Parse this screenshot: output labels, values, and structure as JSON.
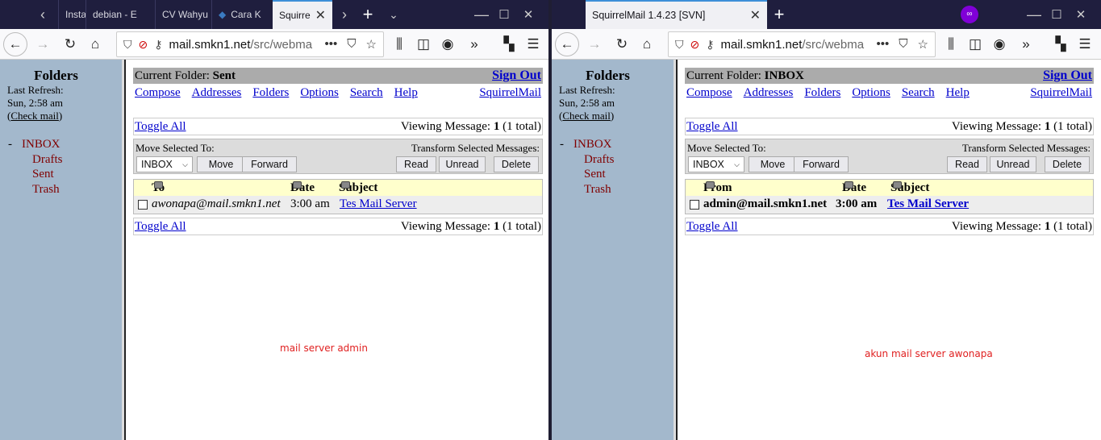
{
  "windows": [
    {
      "tabs": [
        "Install",
        "debian - E",
        "CV Wahyu",
        "Cara K",
        "Squirre"
      ],
      "url": {
        "host": "mail.smkn1.net",
        "path": "/src/webma"
      },
      "folders": {
        "title": "Folders",
        "last_refresh": "Last Refresh:",
        "time": "Sun, 2:58 am",
        "check_mail": "Check mail",
        "items": [
          "INBOX",
          "Drafts",
          "Sent",
          "Trash"
        ],
        "collapse": "-"
      },
      "current_folder_label": "Current Folder:",
      "current_folder": "Sent",
      "sign_out": "Sign Out",
      "nav": [
        "Compose",
        "Addresses",
        "Folders",
        "Options",
        "Search",
        "Help"
      ],
      "brand": "SquirrelMail",
      "toggle_all": "Toggle All",
      "viewing_label": "Viewing Message:",
      "viewing_num": "1",
      "viewing_total": "(1 total)",
      "move_label": "Move Selected To:",
      "transform_label": "Transform Selected Messages:",
      "move_select": "INBOX",
      "buttons": [
        "Move",
        "Forward",
        "Read",
        "Unread",
        "Delete"
      ],
      "columns": [
        "To",
        "Date",
        "Subject"
      ],
      "message": {
        "addr": "awonapa@mail.smkn1.net",
        "date": "3:00 am",
        "subject": "Tes Mail Server"
      },
      "note": "mail server admin"
    },
    {
      "tabs": [
        "SquirrelMail 1.4.23 [SVN]"
      ],
      "url": {
        "host": "mail.smkn1.net",
        "path": "/src/webma"
      },
      "folders": {
        "title": "Folders",
        "last_refresh": "Last Refresh:",
        "time": "Sun, 2:58 am",
        "check_mail": "Check mail",
        "items": [
          "INBOX",
          "Drafts",
          "Sent",
          "Trash"
        ],
        "collapse": "-"
      },
      "current_folder_label": "Current Folder:",
      "current_folder": "INBOX",
      "sign_out": "Sign Out",
      "nav": [
        "Compose",
        "Addresses",
        "Folders",
        "Options",
        "Search",
        "Help"
      ],
      "brand": "SquirrelMail",
      "toggle_all": "Toggle All",
      "viewing_label": "Viewing Message:",
      "viewing_num": "1",
      "viewing_total": "(1 total)",
      "move_label": "Move Selected To:",
      "transform_label": "Transform Selected Messages:",
      "move_select": "INBOX",
      "buttons": [
        "Move",
        "Forward",
        "Read",
        "Unread",
        "Delete"
      ],
      "columns": [
        "From",
        "Date",
        "Subject"
      ],
      "message": {
        "addr": "admin@mail.smkn1.net",
        "date": "3:00 am",
        "subject": "Tes Mail Server"
      },
      "note": "akun mail server awonapa"
    }
  ],
  "colors": {
    "tabbar": "#1f1e3e",
    "folder_pane": "#a3b8cc",
    "folder_link": "#800000",
    "header_row": "#ffffcc",
    "note": "#e02020",
    "private_badge": "#8000d7"
  }
}
